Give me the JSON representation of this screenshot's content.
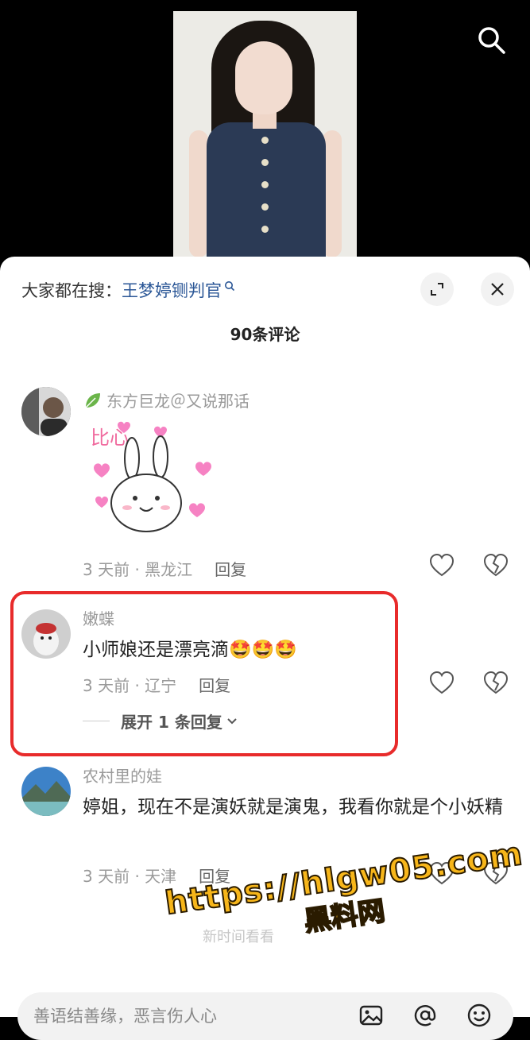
{
  "header": {
    "prefix": "大家都在搜：",
    "hot_search": "王梦婷铡判官",
    "comment_count": "90条评论"
  },
  "comments": [
    {
      "user": "东方巨龙＠又说那话",
      "sticker_text": "比心",
      "time_location": "3 天前 · 黑龙江",
      "reply": "回复"
    },
    {
      "user": "嫩蝶",
      "text": "小师娘还是漂亮滴🤩🤩🤩",
      "time_location": "3 天前 · 辽宁",
      "reply": "回复",
      "expand": "展开 1 条回复"
    },
    {
      "user": "农村里的娃",
      "text": "婷姐，现在不是演妖就是演鬼，我看你就是个小妖精",
      "time_location": "3 天前 · 天津",
      "reply": "回复"
    }
  ],
  "newest_hint": "新时间看看",
  "input": {
    "placeholder": "善语结善缘，恶言伤人心"
  },
  "watermark": {
    "url": "https://hlgw05.com",
    "name": "黑料网"
  },
  "colors": {
    "highlight": "#e82b2b",
    "link": "#2a5696",
    "watermark": "#f7b61a"
  }
}
